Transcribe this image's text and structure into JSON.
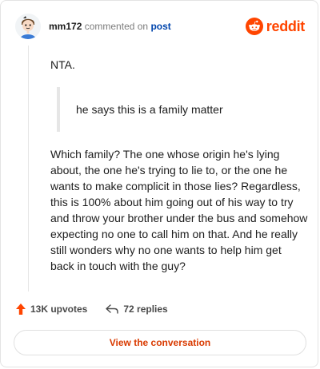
{
  "comment": {
    "author": "mm172",
    "verb": "commented on",
    "post_link": "post",
    "brand": "reddit",
    "paragraph1": "NTA.",
    "quote": "he says this is a family matter",
    "paragraph2": "Which family? The one whose origin he's lying about, the one he's trying to lie to, or the one he wants to make complicit in those lies? Regardless, this is 100% about him going out of his way to try and throw your brother under the bus and somehow expecting no one to call him on that. And he really still wonders why no one wants to help him get back in touch with the guy?"
  },
  "footer": {
    "upvotes": "13K upvotes",
    "replies": "72 replies",
    "cta": "View the conversation"
  },
  "colors": {
    "accent": "#ff4500",
    "link": "#0045ac",
    "cta": "#d93a00"
  }
}
